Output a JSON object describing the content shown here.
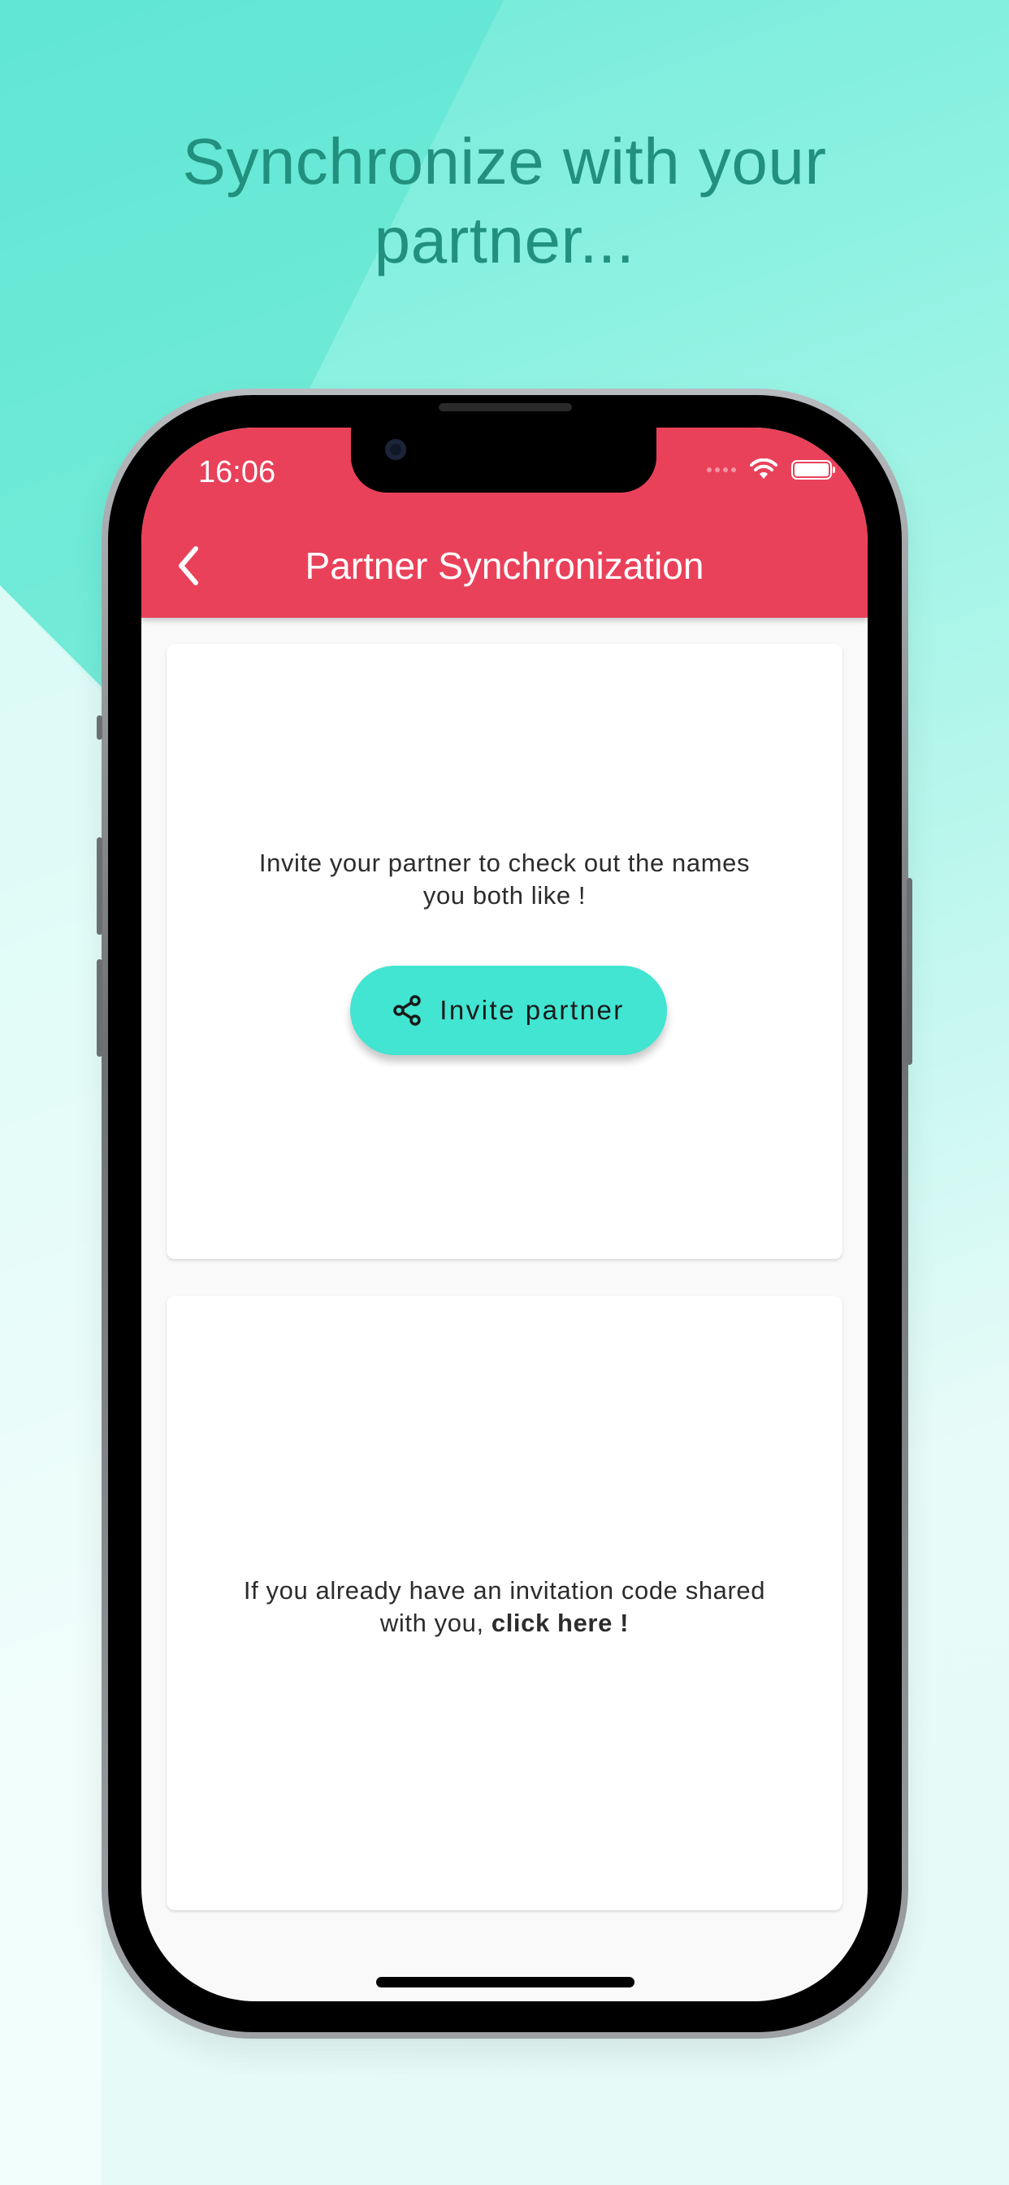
{
  "headline": {
    "line1": "Synchronize with your",
    "line2": "partner..."
  },
  "status_bar": {
    "time": "16:06"
  },
  "app_bar": {
    "title": "Partner Synchronization",
    "back_icon": "chevron-left-icon"
  },
  "invite_card": {
    "message_line1": "Invite your partner to check out the names",
    "message_line2": "you both like !",
    "button_label": "Invite partner",
    "button_icon": "share-icon"
  },
  "code_card": {
    "message_line1": "If you already have an invitation code shared",
    "message_line2_prefix": "with you, ",
    "link_text": "click here !"
  },
  "colors": {
    "app_bar": "#ea415a",
    "accent": "#41e5d1",
    "headline": "#22907e"
  }
}
